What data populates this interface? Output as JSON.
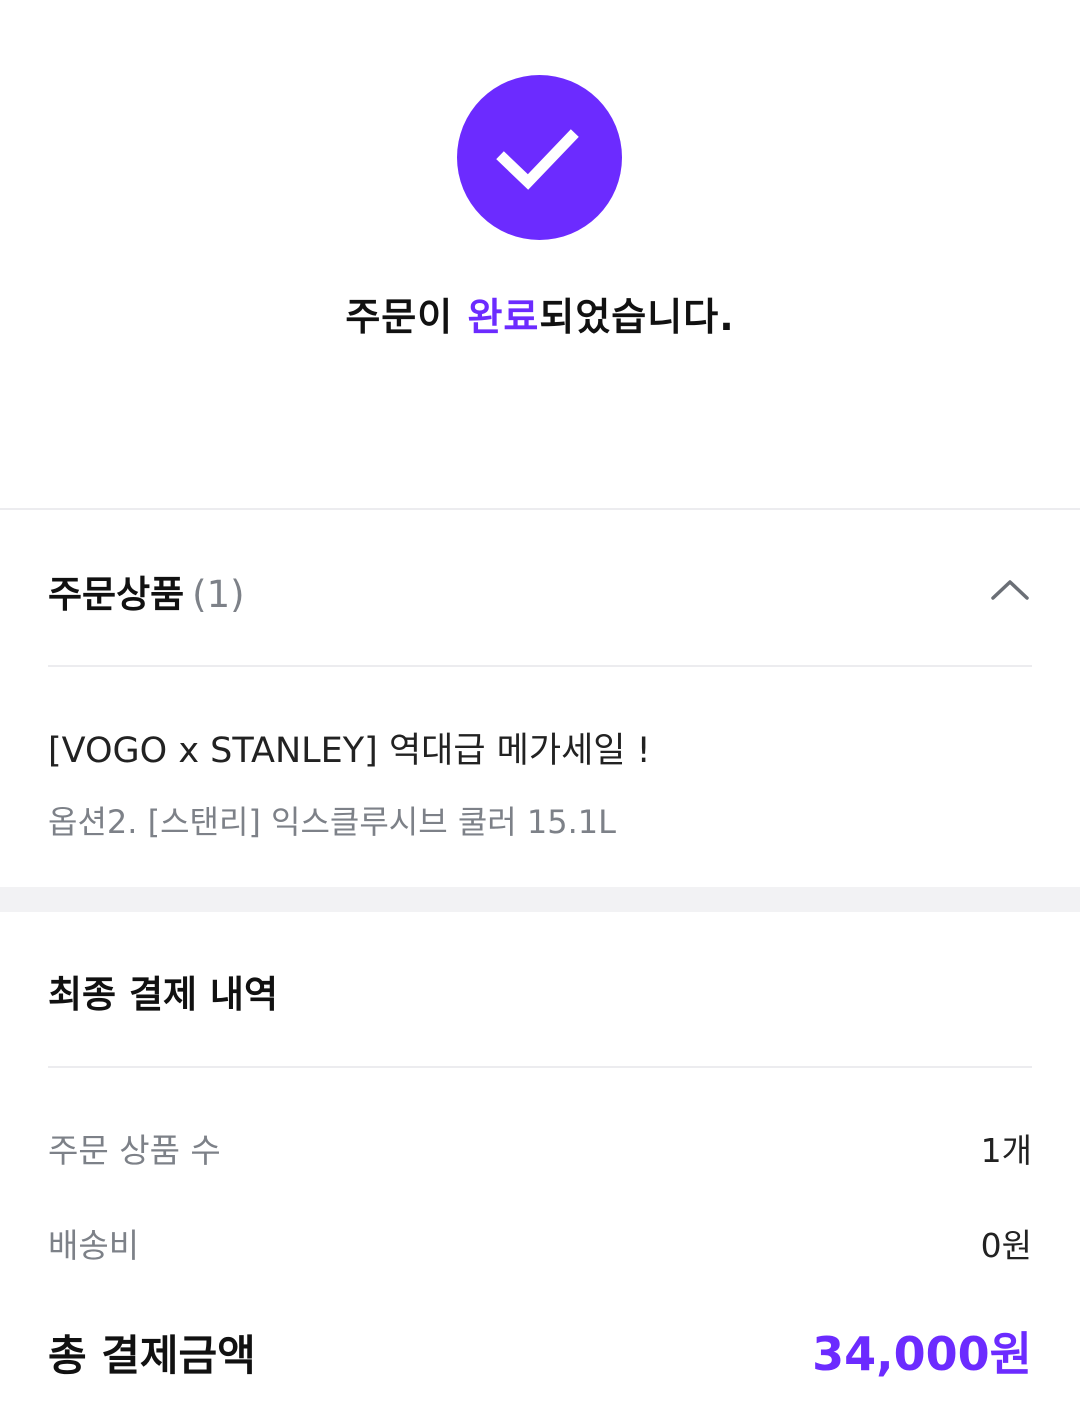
{
  "completion": {
    "icon": "check-icon",
    "message_prefix": "주문이 ",
    "message_accent": "완료",
    "message_suffix": "되었습니다.",
    "accent_color": "#6c2bff"
  },
  "order_products": {
    "title": "주문상품",
    "count": "(1)",
    "toggle_icon": "chevron-up-icon",
    "items": [
      {
        "name": "[VOGO x STANLEY] 역대급 메가세일 !",
        "option": "옵션2. [스탠리] 익스클루시브 쿨러 15.1L"
      }
    ]
  },
  "payment": {
    "title": "최종 결제 내역",
    "rows": [
      {
        "label": "주문 상품 수",
        "value": "1개"
      },
      {
        "label": "배송비",
        "value": "0원"
      }
    ],
    "total_label": "총 결제금액",
    "total_value": "34,000원"
  }
}
